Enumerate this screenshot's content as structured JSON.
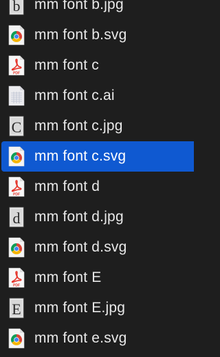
{
  "files": [
    {
      "name": "mm font b.jpg",
      "icon": "jpg-thumbnail-b-icon",
      "glyph": "b",
      "type": "jpg"
    },
    {
      "name": "mm font b.svg",
      "icon": "chrome-svg-icon",
      "type": "svg"
    },
    {
      "name": "mm font c",
      "icon": "pdf-document-icon",
      "type": "pdf"
    },
    {
      "name": "mm font c.ai",
      "icon": "ai-document-icon",
      "type": "ai"
    },
    {
      "name": "mm font c.jpg",
      "icon": "jpg-thumbnail-c-icon",
      "glyph": "C",
      "type": "jpg"
    },
    {
      "name": "mm font c.svg",
      "icon": "chrome-svg-icon",
      "type": "svg",
      "selected": true
    },
    {
      "name": "mm font d",
      "icon": "pdf-document-icon",
      "type": "pdf"
    },
    {
      "name": "mm font d.jpg",
      "icon": "jpg-thumbnail-d-icon",
      "glyph": "d",
      "type": "jpg"
    },
    {
      "name": "mm font d.svg",
      "icon": "chrome-svg-icon",
      "type": "svg"
    },
    {
      "name": "mm font E",
      "icon": "pdf-document-icon",
      "type": "pdf"
    },
    {
      "name": "mm font E.jpg",
      "icon": "jpg-thumbnail-e-icon",
      "glyph": "E",
      "type": "jpg"
    },
    {
      "name": "mm font e.svg",
      "icon": "chrome-svg-icon",
      "type": "svg"
    }
  ],
  "colors": {
    "background": "#1e1e1e",
    "selection": "#0f59d1",
    "text": "#e8e8e8",
    "pdf_red": "#e5352b"
  }
}
